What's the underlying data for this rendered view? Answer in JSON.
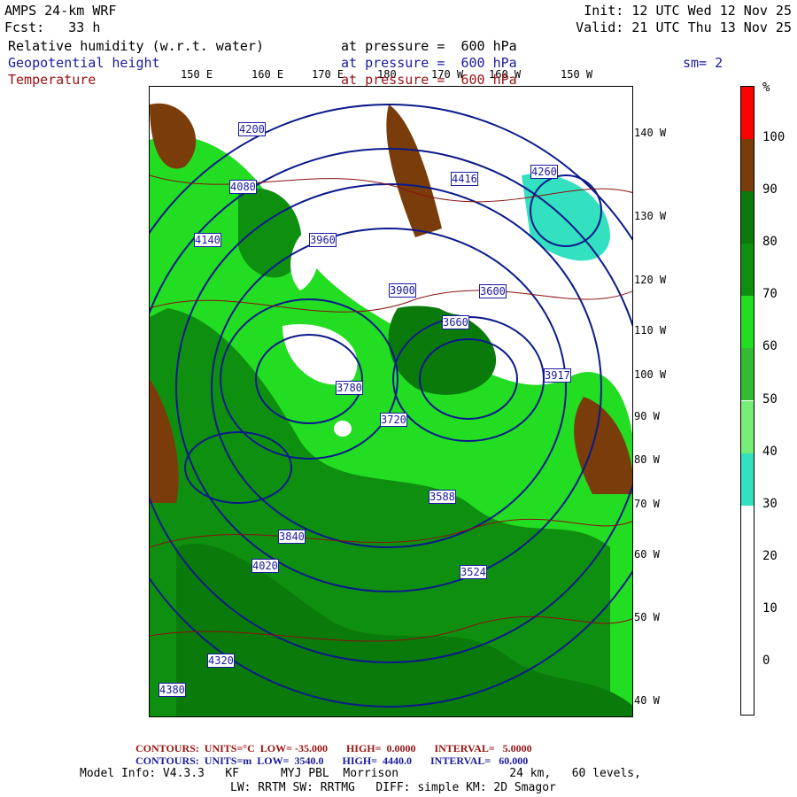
{
  "header": {
    "model": "AMPS 24-km WRF",
    "fcst": "Fcst:   33 h",
    "init": "Init: 12 UTC Wed 12 Nov 25",
    "valid": "Valid: 21 UTC Thu 13 Nov 25",
    "rh_label": "Relative humidity (w.r.t. water)",
    "rh_level": "at pressure =  600 hPa",
    "gh_label": "Geopotential height",
    "gh_level": "at pressure =  600 hPa",
    "sm": "sm= 2",
    "t_label": "Temperature",
    "t_level": "at pressure =  600 hPa"
  },
  "lon_labels": [
    "150 E",
    "160 E",
    "170 E",
    "180",
    "170 W",
    "160 W",
    "150 W"
  ],
  "lat_labels": [
    "140 W",
    "130 W",
    "120 W",
    "110 W",
    "100 W",
    "90 W",
    "80 W",
    "70 W",
    "60 W",
    "50 W",
    "40 W"
  ],
  "colorbar": {
    "unit": "%",
    "labels": [
      "100",
      "90",
      "80",
      "70",
      "60",
      "50",
      "40",
      "30",
      "20",
      "10",
      "0"
    ],
    "colors": [
      "#ff0000",
      "#7a3c0a",
      "#0a7a0a",
      "#0f8f0f",
      "#22dd22",
      "#33bb33",
      "#77ee77",
      "#33e0c0",
      "#ffffff",
      "#ffffff",
      "#ffffff",
      "#ffffff"
    ]
  },
  "contour_labels": [
    "4200",
    "4260",
    "4140",
    "4080",
    "3960",
    "3900",
    "3840",
    "3780",
    "3720",
    "3660",
    "3600",
    "4020",
    "4320",
    "4380",
    "4416",
    "3917",
    "3588",
    "3524"
  ],
  "footer": {
    "t_contours": "CONTOURS:  UNITS=°C  LOW= -35.000       HIGH=  0.0000       INTERVAL=   5.0000",
    "gh_contours": "CONTOURS:  UNITS=m  LOW=  3540.0       HIGH=  4440.0       INTERVAL=   60.000",
    "model_info": "Model Info: V4.3.3   KF      MYJ PBL  Morrison                24 km,   60 levels,",
    "physics": "LW: RRTM SW: RRTMG   DIFF: simple KM: 2D Smagor"
  }
}
